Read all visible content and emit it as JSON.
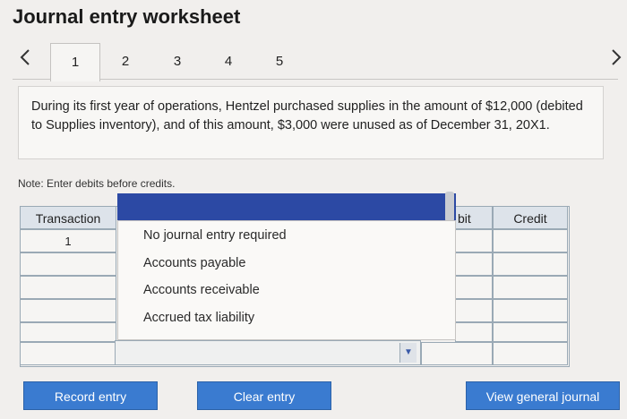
{
  "page": {
    "title": "Journal entry worksheet"
  },
  "tabs": [
    {
      "label": "1",
      "active": true
    },
    {
      "label": "2"
    },
    {
      "label": "3"
    },
    {
      "label": "4"
    },
    {
      "label": "5"
    }
  ],
  "nav": {
    "prev_icon": "chevron-left-icon",
    "next_icon": "chevron-right-icon"
  },
  "description": "During its first year of operations, Hentzel purchased supplies in the amount of $12,000 (debited to Supplies inventory), and of this amount, $3,000 were unused as of December 31, 20X1.",
  "note": "Note: Enter debits before credits.",
  "table": {
    "headers": {
      "transaction": "Transaction",
      "debit_partial": "bit",
      "credit": "Credit"
    },
    "rows": [
      {
        "transaction": "1"
      }
    ]
  },
  "account_dropdown": {
    "options": [
      "No journal entry required",
      "Accounts payable",
      "Accounts receivable",
      "Accrued tax liability"
    ]
  },
  "buttons": {
    "record": "Record entry",
    "clear": "Clear entry",
    "view_journal": "View general journal"
  },
  "colors": {
    "accent": "#3a7bd0",
    "dropdown_highlight": "#2c49a4"
  }
}
